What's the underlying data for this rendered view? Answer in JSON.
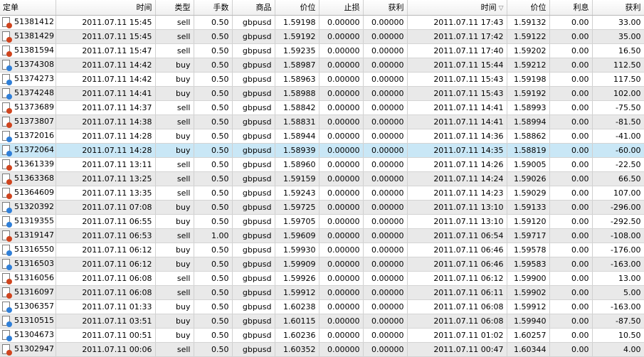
{
  "columns": [
    "定单",
    "时间",
    "类型",
    "手数",
    "商品",
    "价位",
    "止损",
    "获利",
    "时间",
    "价位",
    "利息",
    "获利"
  ],
  "sort_indicator": "▽",
  "rows": [
    [
      "51381412",
      "2011.07.11 15:45",
      "sell",
      "0.50",
      "gbpusd",
      "1.59198",
      "0.00000",
      "0.00000",
      "2011.07.11 17:43",
      "1.59132",
      "0.00",
      "33.00"
    ],
    [
      "51381429",
      "2011.07.11 15:45",
      "sell",
      "0.50",
      "gbpusd",
      "1.59192",
      "0.00000",
      "0.00000",
      "2011.07.11 17:42",
      "1.59122",
      "0.00",
      "35.00"
    ],
    [
      "51381594",
      "2011.07.11 15:47",
      "sell",
      "0.50",
      "gbpusd",
      "1.59235",
      "0.00000",
      "0.00000",
      "2011.07.11 17:40",
      "1.59202",
      "0.00",
      "16.50"
    ],
    [
      "51374308",
      "2011.07.11 14:42",
      "buy",
      "0.50",
      "gbpusd",
      "1.58987",
      "0.00000",
      "0.00000",
      "2011.07.11 15:44",
      "1.59212",
      "0.00",
      "112.50"
    ],
    [
      "51374273",
      "2011.07.11 14:42",
      "buy",
      "0.50",
      "gbpusd",
      "1.58963",
      "0.00000",
      "0.00000",
      "2011.07.11 15:43",
      "1.59198",
      "0.00",
      "117.50"
    ],
    [
      "51374248",
      "2011.07.11 14:41",
      "buy",
      "0.50",
      "gbpusd",
      "1.58988",
      "0.00000",
      "0.00000",
      "2011.07.11 15:43",
      "1.59192",
      "0.00",
      "102.00"
    ],
    [
      "51373689",
      "2011.07.11 14:37",
      "sell",
      "0.50",
      "gbpusd",
      "1.58842",
      "0.00000",
      "0.00000",
      "2011.07.11 14:41",
      "1.58993",
      "0.00",
      "-75.50"
    ],
    [
      "51373807",
      "2011.07.11 14:38",
      "sell",
      "0.50",
      "gbpusd",
      "1.58831",
      "0.00000",
      "0.00000",
      "2011.07.11 14:41",
      "1.58994",
      "0.00",
      "-81.50"
    ],
    [
      "51372016",
      "2011.07.11 14:28",
      "buy",
      "0.50",
      "gbpusd",
      "1.58944",
      "0.00000",
      "0.00000",
      "2011.07.11 14:36",
      "1.58862",
      "0.00",
      "-41.00"
    ],
    [
      "51372064",
      "2011.07.11 14:28",
      "buy",
      "0.50",
      "gbpusd",
      "1.58939",
      "0.00000",
      "0.00000",
      "2011.07.11 14:35",
      "1.58819",
      "0.00",
      "-60.00"
    ],
    [
      "51361339",
      "2011.07.11 13:11",
      "sell",
      "0.50",
      "gbpusd",
      "1.58960",
      "0.00000",
      "0.00000",
      "2011.07.11 14:26",
      "1.59005",
      "0.00",
      "-22.50"
    ],
    [
      "51363368",
      "2011.07.11 13:25",
      "sell",
      "0.50",
      "gbpusd",
      "1.59159",
      "0.00000",
      "0.00000",
      "2011.07.11 14:24",
      "1.59026",
      "0.00",
      "66.50"
    ],
    [
      "51364609",
      "2011.07.11 13:35",
      "sell",
      "0.50",
      "gbpusd",
      "1.59243",
      "0.00000",
      "0.00000",
      "2011.07.11 14:23",
      "1.59029",
      "0.00",
      "107.00"
    ],
    [
      "51320392",
      "2011.07.11 07:08",
      "buy",
      "0.50",
      "gbpusd",
      "1.59725",
      "0.00000",
      "0.00000",
      "2011.07.11 13:10",
      "1.59133",
      "0.00",
      "-296.00"
    ],
    [
      "51319355",
      "2011.07.11 06:55",
      "buy",
      "0.50",
      "gbpusd",
      "1.59705",
      "0.00000",
      "0.00000",
      "2011.07.11 13:10",
      "1.59120",
      "0.00",
      "-292.50"
    ],
    [
      "51319147",
      "2011.07.11 06:53",
      "sell",
      "1.00",
      "gbpusd",
      "1.59609",
      "0.00000",
      "0.00000",
      "2011.07.11 06:54",
      "1.59717",
      "0.00",
      "-108.00"
    ],
    [
      "51316550",
      "2011.07.11 06:12",
      "buy",
      "0.50",
      "gbpusd",
      "1.59930",
      "0.00000",
      "0.00000",
      "2011.07.11 06:46",
      "1.59578",
      "0.00",
      "-176.00"
    ],
    [
      "51316503",
      "2011.07.11 06:12",
      "buy",
      "0.50",
      "gbpusd",
      "1.59909",
      "0.00000",
      "0.00000",
      "2011.07.11 06:46",
      "1.59583",
      "0.00",
      "-163.00"
    ],
    [
      "51316056",
      "2011.07.11 06:08",
      "sell",
      "0.50",
      "gbpusd",
      "1.59926",
      "0.00000",
      "0.00000",
      "2011.07.11 06:12",
      "1.59900",
      "0.00",
      "13.00"
    ],
    [
      "51316097",
      "2011.07.11 06:08",
      "sell",
      "0.50",
      "gbpusd",
      "1.59912",
      "0.00000",
      "0.00000",
      "2011.07.11 06:11",
      "1.59902",
      "0.00",
      "5.00"
    ],
    [
      "51306357",
      "2011.07.11 01:33",
      "buy",
      "0.50",
      "gbpusd",
      "1.60238",
      "0.00000",
      "0.00000",
      "2011.07.11 06:08",
      "1.59912",
      "0.00",
      "-163.00"
    ],
    [
      "51310515",
      "2011.07.11 03:51",
      "buy",
      "0.50",
      "gbpusd",
      "1.60115",
      "0.00000",
      "0.00000",
      "2011.07.11 06:08",
      "1.59940",
      "0.00",
      "-87.50"
    ],
    [
      "51304673",
      "2011.07.11 00:51",
      "buy",
      "0.50",
      "gbpusd",
      "1.60236",
      "0.00000",
      "0.00000",
      "2011.07.11 01:02",
      "1.60257",
      "0.00",
      "10.50"
    ],
    [
      "51302947",
      "2011.07.11 00:06",
      "sell",
      "0.50",
      "gbpusd",
      "1.60352",
      "0.00000",
      "0.00000",
      "2011.07.11 00:47",
      "1.60344",
      "0.00",
      "4.00"
    ]
  ],
  "selected_row_index": 9,
  "icons": {
    "sell": "order-sell-icon",
    "buy": "order-buy-icon"
  },
  "colors": {
    "sell_dot": "#d0441e",
    "buy_dot": "#2f7fd8",
    "selected_row": "#c9e7f6",
    "alt_row": "#e9e9e9"
  }
}
